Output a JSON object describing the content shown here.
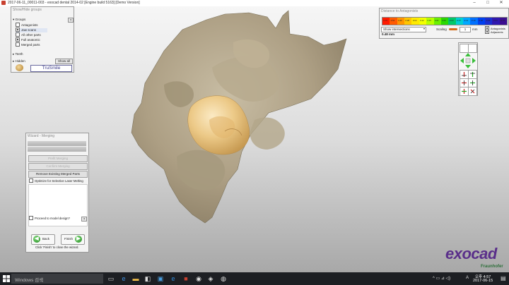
{
  "window": {
    "title": "2017-06-11_00011-003 - exocad dental 2014-02 [Engine build 5163] [Demo Version]",
    "minimize": "–",
    "maximize": "□",
    "close": "✕"
  },
  "show_hide": {
    "title": "Show/Hide groups",
    "groups_label": "Groups",
    "groups_help": "?",
    "items": [
      {
        "label": "Antagonists",
        "checked": false
      },
      {
        "label": "Jaw scans",
        "checked": true
      },
      {
        "label": "All other parts",
        "checked": false
      },
      {
        "label": "Full anatomic",
        "checked": true
      },
      {
        "label": "Merged parts",
        "checked": false
      }
    ],
    "teeth_label": "Teeth",
    "hidden_label": "Hidden",
    "show_all": "Show all",
    "trusmile": "TruSmile"
  },
  "antagonists": {
    "title": "Distance to Antagonists",
    "scale_labels": [
      "0.75",
      "0.54",
      "0.40",
      "0.28",
      "0.19",
      "0.12",
      "0.07",
      "0.03",
      "0.00",
      "-0.03",
      "-0.07",
      "-0.12",
      "-0.19",
      "-0.28",
      "-0.40",
      "-0.54",
      "-0.75"
    ],
    "scale_colors": [
      "#ff1a00",
      "#ff5a00",
      "#ff9500",
      "#ffc400",
      "#ffea00",
      "#f3ff00",
      "#b8ff00",
      "#6bf000",
      "#2bd800",
      "#00c86a",
      "#00cfd2",
      "#00a8ff",
      "#0070ff",
      "#0040f0",
      "#1b2fd0",
      "#3018b0",
      "#3b0d90"
    ],
    "intersections": "Show intersections",
    "scaling_label": "Scaling",
    "scaling_value": "1",
    "unit": "mm",
    "check_antagonists": "Antagonists",
    "check_adjacents": "Adjacents",
    "distance": "0.48 mm"
  },
  "wizard": {
    "title": "Wizard - Merging",
    "btn_disabled_1": "Prefit Merging",
    "btn_disabled_2": "Confirm Merging",
    "btn_remove": "Remove Existing Merged Parts",
    "optimize": "Optimize for Selective Laser Melting",
    "proceed": "Proceed to model design?",
    "help": "?",
    "back": "Back",
    "finish": "Finish",
    "hint": "Click 'Finish' to close the wizard."
  },
  "branding": {
    "logo": "exocad",
    "sub": "Fraunhofer",
    "colors": {
      "logo": "#5a2f8a"
    }
  },
  "taskbar": {
    "start_icon": "windows-logo-icon",
    "search_placeholder": "Windows 검색",
    "time": "오후 4:57",
    "date": "2017-06-15",
    "lang": "A",
    "tray": "^ ▭ ⊿ ◁)"
  }
}
